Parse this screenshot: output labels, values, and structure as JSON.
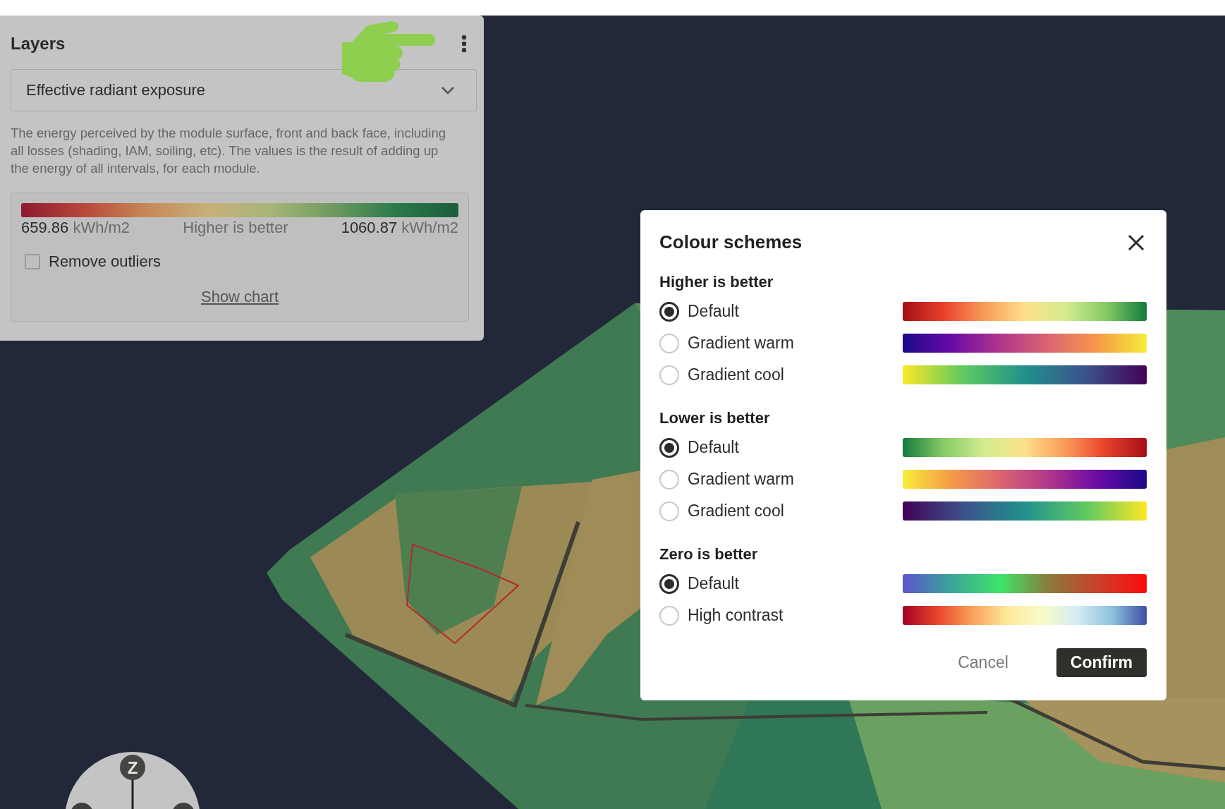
{
  "layers_panel": {
    "title": "Layers",
    "layer_select": {
      "value": "Effective radiant exposure"
    },
    "description": "The energy perceived by the module surface, front and back face, including all losses (shading, IAM, soiling, etc). The values is the result of adding up the energy of all intervals, for each module.",
    "legend": {
      "min_value": "659.86",
      "min_unit": "kWh/m2",
      "caption": "Higher is better",
      "max_value": "1060.87",
      "max_unit": "kWh/m2"
    },
    "remove_outliers": {
      "label": "Remove outliers",
      "checked": false
    },
    "show_chart_link": "Show chart"
  },
  "dialog": {
    "title": "Colour schemes",
    "groups": [
      {
        "heading": "Higher is better",
        "options": [
          {
            "label": "Default",
            "selected": true,
            "kind": "redgreen"
          },
          {
            "label": "Gradient warm",
            "selected": false,
            "kind": "plasma"
          },
          {
            "label": "Gradient cool",
            "selected": false,
            "kind": "viridisrev"
          }
        ]
      },
      {
        "heading": "Lower is better",
        "options": [
          {
            "label": "Default",
            "selected": true,
            "kind": "greenred"
          },
          {
            "label": "Gradient warm",
            "selected": false,
            "kind": "plasmarev"
          },
          {
            "label": "Gradient cool",
            "selected": false,
            "kind": "viridis"
          }
        ]
      },
      {
        "heading": "Zero is better",
        "options": [
          {
            "label": "Default",
            "selected": true,
            "kind": "rainbow"
          },
          {
            "label": "High contrast",
            "selected": false,
            "kind": "rdylbu"
          }
        ]
      }
    ],
    "buttons": [
      {
        "label": "Cancel",
        "kind": "text"
      },
      {
        "label": "Confirm",
        "kind": "primary"
      }
    ]
  },
  "compass": {
    "axis_label": "Z"
  }
}
